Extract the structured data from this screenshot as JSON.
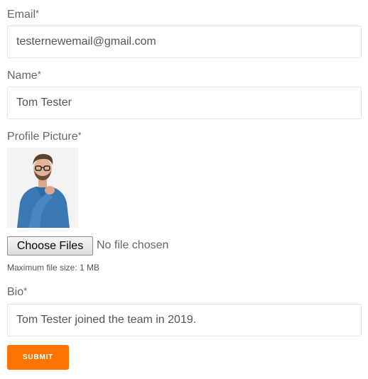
{
  "form": {
    "email": {
      "label": "Email",
      "required_mark": "*",
      "value": "testernewemail@gmail.com"
    },
    "name": {
      "label": "Name",
      "required_mark": "*",
      "value": "Tom Tester"
    },
    "profile_picture": {
      "label": "Profile Picture",
      "required_mark": "*",
      "choose_label": "Choose Files",
      "file_status": "No file chosen",
      "max_size_hint": "Maximum file size: 1 MB"
    },
    "bio": {
      "label": "Bio",
      "required_mark": "*",
      "value": "Tom Tester joined the team in 2019."
    },
    "submit_label": "SUBMIT"
  },
  "colors": {
    "accent": "#ff7300",
    "field_border": "#e2e2e2",
    "label_text": "#666666"
  }
}
